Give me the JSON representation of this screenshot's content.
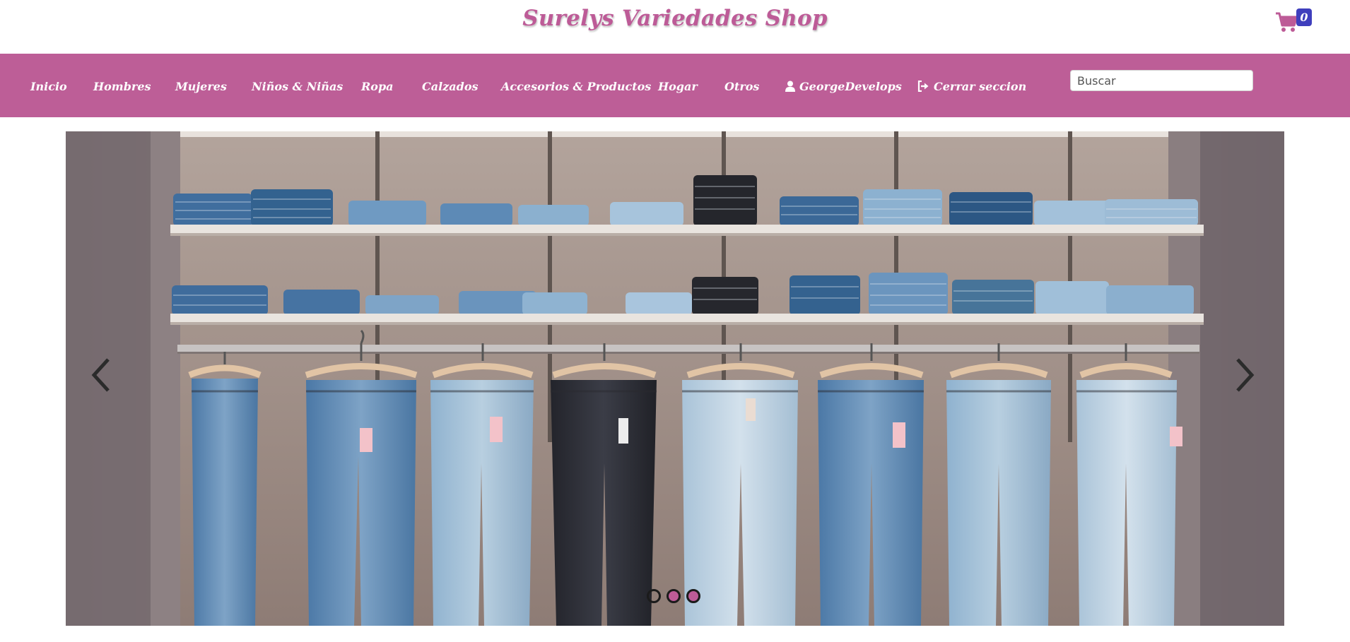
{
  "header": {
    "brand": "Surelys Variedades Shop",
    "cart_count": "0",
    "cart_icon": "shopping-cart-icon",
    "brand_color": "#bd5b97",
    "badge_color": "#3f3fbd"
  },
  "nav": {
    "background": "#bd5e97",
    "items": [
      {
        "label": "Inicio"
      },
      {
        "label": "Hombres"
      },
      {
        "label": "Mujeres"
      },
      {
        "label": "Niños & Niñas"
      },
      {
        "label": "Ropa"
      },
      {
        "label": "Calzados"
      },
      {
        "label": "Accesorios & Productos"
      },
      {
        "label": "Hogar"
      },
      {
        "label": "Otros"
      },
      {
        "label": "GeorgeDevelops",
        "icon": "user-icon"
      },
      {
        "label": "Cerrar seccion",
        "icon": "sign-out-icon"
      }
    ],
    "search_placeholder": "Buscar",
    "search_value": ""
  },
  "carousel": {
    "image_subject": "jeans-on-shelves-and-hangers",
    "slide_count": 3,
    "active_slide": 1,
    "prev_icon": "chevron-left-icon",
    "next_icon": "chevron-right-icon"
  }
}
